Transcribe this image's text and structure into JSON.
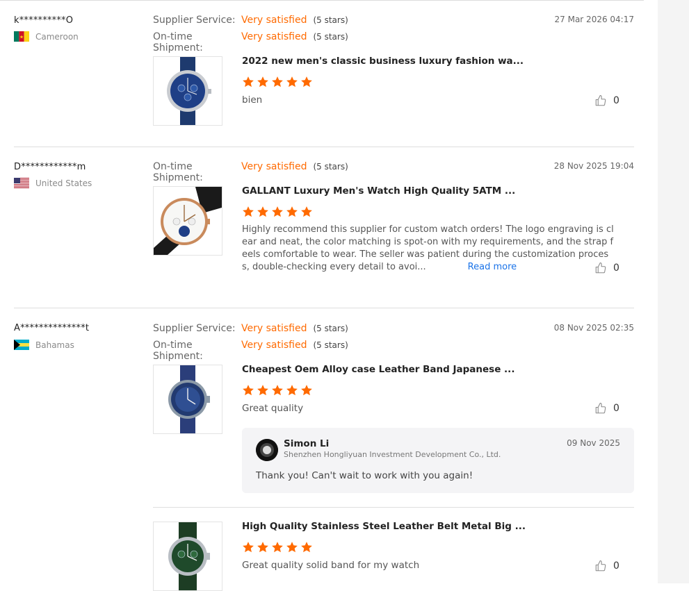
{
  "colors": {
    "accent": "#ff6a00",
    "link": "#1a73e8"
  },
  "reviews": [
    {
      "buyer": "k**********O",
      "country": "Cameroon",
      "date": "27 Mar 2026 04:17",
      "ratings": [
        {
          "label": "Supplier Service:",
          "value": "Very satisfied",
          "stars": "(5 stars)"
        },
        {
          "label": "On-time Shipment:",
          "value": "Very satisfied",
          "stars": "(5 stars)"
        }
      ],
      "product_title": "2022 new men's classic business luxury fashion wa...",
      "product_stars": 5,
      "comment": "bien",
      "likes": "0"
    },
    {
      "buyer": "D************m",
      "country": "United States",
      "date": "28 Nov 2025 19:04",
      "ratings": [
        {
          "label": "On-time Shipment:",
          "value": "Very satisfied",
          "stars": "(5 stars)"
        }
      ],
      "product_title": "GALLANT Luxury Men's Watch High Quality 5ATM ...",
      "product_stars": 5,
      "comment_lines": [
        "Highly recommend this supplier for custom watch orders! The logo engraving is cl",
        "ear and neat, the color matching is spot-on with my requirements, and the strap f",
        "eels comfortable to wear. The seller was patient during the customization proces",
        "s, double-checking every detail to avoi..."
      ],
      "read_more": "Read more",
      "likes": "0"
    },
    {
      "buyer": "A**************t",
      "country": "Bahamas",
      "date": "08 Nov 2025 02:35",
      "ratings": [
        {
          "label": "Supplier Service:",
          "value": "Very satisfied",
          "stars": "(5 stars)"
        },
        {
          "label": "On-time Shipment:",
          "value": "Very satisfied",
          "stars": "(5 stars)"
        }
      ],
      "products": [
        {
          "product_title": "Cheapest Oem Alloy case Leather Band Japanese ...",
          "product_stars": 5,
          "comment": "Great quality",
          "likes": "0",
          "reply": {
            "name": "Simon Li",
            "company": "Shenzhen Hongliyuan Investment Development Co., Ltd.",
            "date": "09 Nov 2025",
            "text": "Thank you! Can't wait to work with you again!"
          }
        },
        {
          "product_title": "High Quality Stainless Steel Leather Belt Metal Big ...",
          "product_stars": 5,
          "comment": "Great quality solid band for my watch",
          "likes": "0"
        }
      ]
    }
  ]
}
